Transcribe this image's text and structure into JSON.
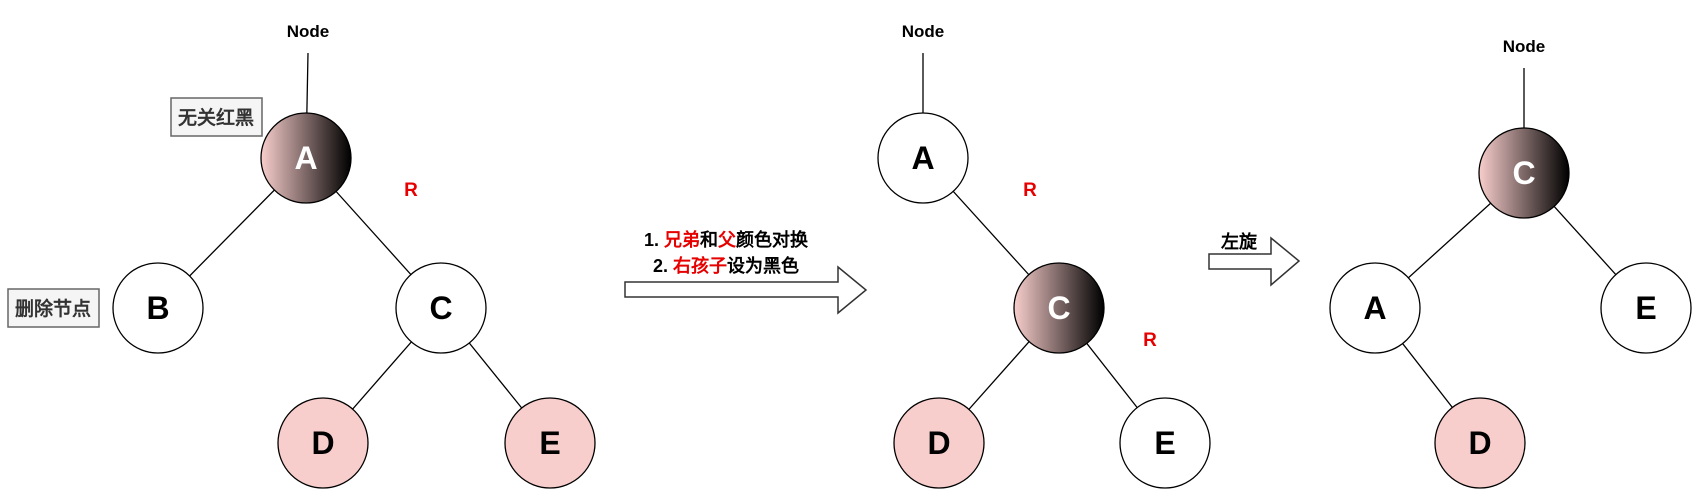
{
  "colors": {
    "red_node": "#f8cecc",
    "annotation": "#e60000",
    "gradient_start": "#f8cecc",
    "gradient_end": "#000000",
    "tag_bg": "#f5f5f5",
    "tag_border": "#666666"
  },
  "panels": [
    {
      "name": "before",
      "root_label": "Node",
      "nodes": {
        "A": {
          "label": "A",
          "color": "gradient"
        },
        "B": {
          "label": "B",
          "color": "black-white"
        },
        "C": {
          "label": "C",
          "color": "black-white"
        },
        "D": {
          "label": "D",
          "color": "red"
        },
        "E": {
          "label": "E",
          "color": "red"
        }
      },
      "edge_labels": [
        "R"
      ],
      "tags": [
        "无关红黑",
        "删除节点"
      ]
    },
    {
      "name": "after-recolor",
      "root_label": "Node",
      "nodes": {
        "A": {
          "label": "A",
          "color": "black-white"
        },
        "C": {
          "label": "C",
          "color": "gradient"
        },
        "D": {
          "label": "D",
          "color": "red"
        },
        "E": {
          "label": "E",
          "color": "black-white"
        }
      },
      "edge_labels": [
        "R",
        "R"
      ]
    },
    {
      "name": "after-rotate",
      "root_label": "Node",
      "nodes": {
        "C": {
          "label": "C",
          "color": "gradient"
        },
        "A": {
          "label": "A",
          "color": "black-white"
        },
        "E": {
          "label": "E",
          "color": "black-white"
        },
        "D": {
          "label": "D",
          "color": "red"
        }
      }
    }
  ],
  "step1": {
    "line1": {
      "prefix": "1. ",
      "red1": "兄弟",
      "mid": "和",
      "red2": "父",
      "suffix": "颜色对换"
    },
    "line2": {
      "prefix": "2. ",
      "red": "右孩子",
      "suffix": "设为黑色"
    }
  },
  "step2": {
    "label": "左旋"
  }
}
